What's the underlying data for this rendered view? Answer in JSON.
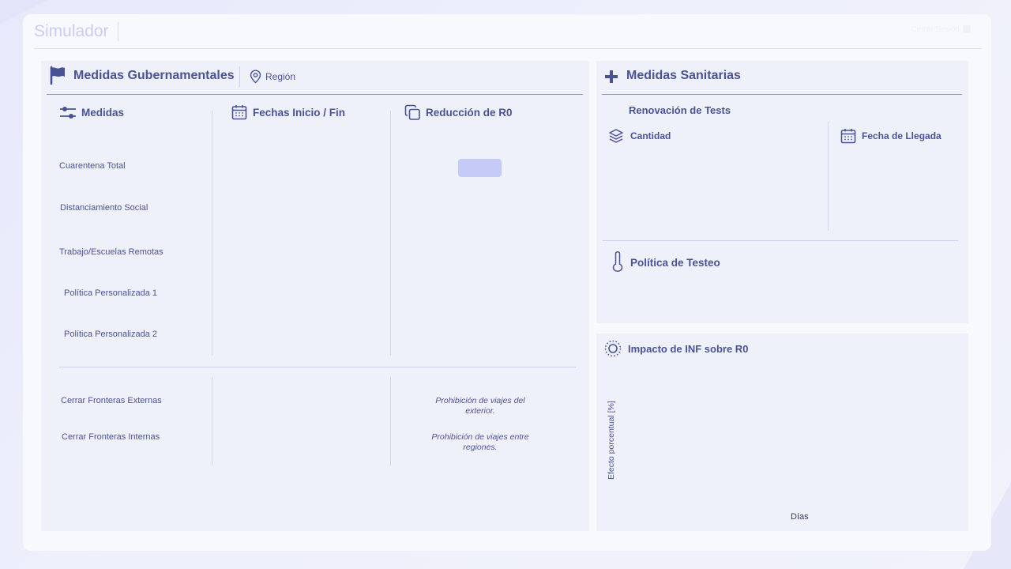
{
  "app": {
    "title": "Simulador",
    "top_right_text": "Cerrar Sesión"
  },
  "gov": {
    "title": "Medidas Gubernamentales",
    "region_label": "Región",
    "col_measures": "Medidas",
    "col_dates": "Fechas Inicio / Fin",
    "col_r0": "Reducción de R0",
    "measures": [
      "Cuarentena Total",
      "Distanciamiento Social",
      "Trabajo/Escuelas Remotas",
      "Política Personalizada 1",
      "Política Personalizada 2"
    ],
    "borders": [
      {
        "label": "Cerrar Fronteras Externas",
        "note": "Prohibición de viajes del exterior."
      },
      {
        "label": "Cerrar Fronteras Internas",
        "note": "Prohibición de viajes entre regiones."
      }
    ]
  },
  "health": {
    "title": "Medidas Sanitarias",
    "tests_title": "Renovación de Tests",
    "quantity_label": "Cantidad",
    "arrival_label": "Fecha de Llegada",
    "policy_title": "Política de Testeo"
  },
  "impact": {
    "title": "Impacto de INF sobre R0",
    "y_label": "Efecto porcentual [%]",
    "x_label": "Días"
  },
  "colors": {
    "accent": "#4a5296",
    "chip": "#c6caf7",
    "panel": "#eef1fa"
  }
}
